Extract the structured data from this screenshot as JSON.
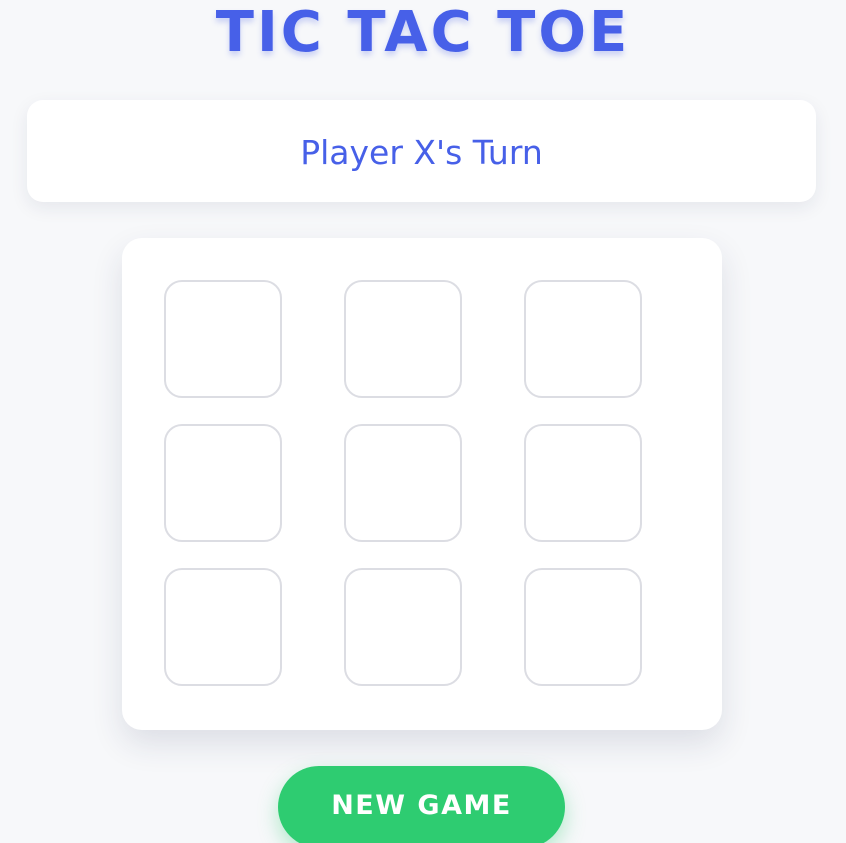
{
  "header": {
    "title": "TIC TAC TOE"
  },
  "status": {
    "text": "Player X's Turn"
  },
  "board": {
    "cells": [
      "",
      "",
      "",
      "",
      "",
      "",
      "",
      "",
      ""
    ]
  },
  "controls": {
    "new_game_label": "NEW GAME"
  },
  "colors": {
    "accent": "#4760e8",
    "button": "#2ecc71",
    "background": "#f7f8fa",
    "cell_border": "#dcdde3"
  }
}
